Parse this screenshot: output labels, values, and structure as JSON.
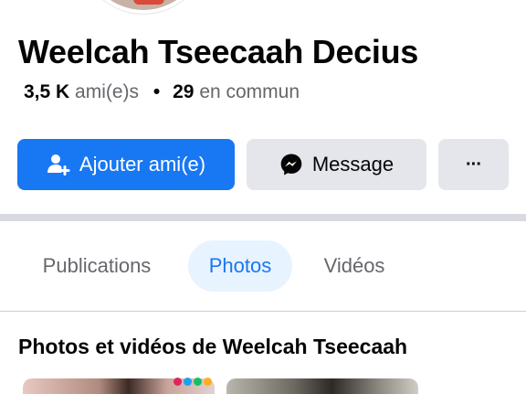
{
  "profile": {
    "name": "Weelcah Tseecaah Decius",
    "friends_count": "3,5 K",
    "friends_label": "ami(e)s",
    "separator": "•",
    "mutual_count": "29",
    "mutual_label": "en commun"
  },
  "actions": {
    "add_friend_label": "Ajouter ami(e)",
    "message_label": "Message",
    "more_label": "···",
    "add_friend_icon": "add-friend-icon",
    "message_icon": "messenger-icon",
    "primary_color": "#1877f2"
  },
  "tabs": [
    {
      "label": "Publications",
      "active": false
    },
    {
      "label": "Photos",
      "active": true
    },
    {
      "label": "Vidéos",
      "active": false
    }
  ],
  "section": {
    "title": "Photos et vidéos de Weelcah Tseecaah"
  }
}
